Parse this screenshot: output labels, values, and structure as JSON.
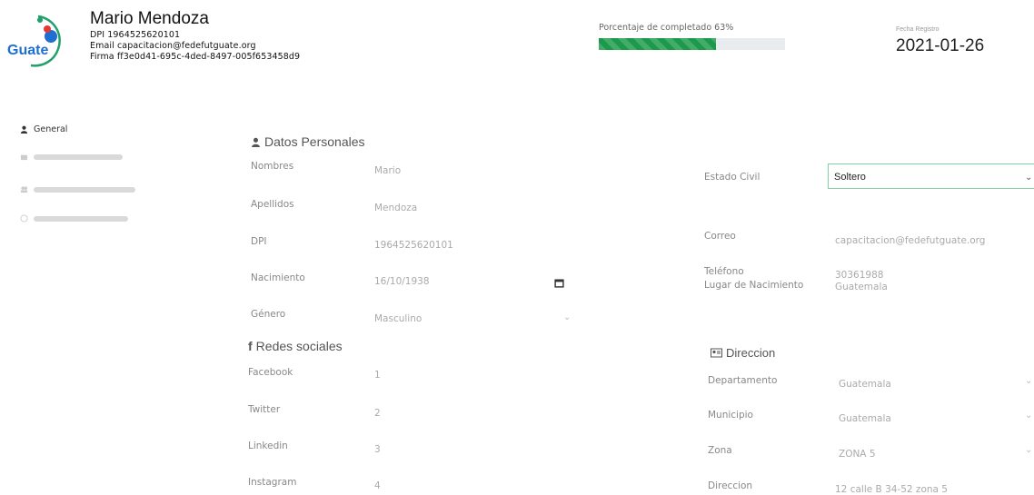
{
  "header": {
    "logo_text": "Guate",
    "name": "Mario Mendoza",
    "dpi_line": "DPI  1964525620101",
    "email_line": "Email  capacitacion@fedefutguate.org",
    "firma_line": "Firma  ff3e0d41-695c-4ded-8497-005f653458d9",
    "progress_label": "Porcentaje de completado 63%",
    "progress_value": 0.63,
    "progress_color": "#1a9a4a",
    "date_label": "Fecha Registro",
    "date_value": "2021-01-26"
  },
  "sidebar": {
    "items": [
      {
        "label": "General",
        "icon": "user-icon",
        "active": true
      },
      {
        "label": "",
        "icon": "briefcase-icon",
        "active": false
      },
      {
        "label": "",
        "icon": "users-icon",
        "active": false
      },
      {
        "label": "",
        "icon": "upload-icon",
        "active": false
      }
    ]
  },
  "personal": {
    "title": "Datos Personales",
    "fields": [
      {
        "label": "Nombres",
        "value": "Mario"
      },
      {
        "label": "Apellidos",
        "value": "Mendoza"
      },
      {
        "label": "DPI",
        "value": "1964525620101"
      },
      {
        "label": "Nacimiento",
        "value": "16/10/1938"
      },
      {
        "label": "Género",
        "value": "Masculino"
      }
    ],
    "right_fields": [
      {
        "label": "Estado Civil",
        "value": "Soltero"
      },
      {
        "label": "Correo",
        "value": "capacitacion@fedefutguate.org"
      },
      {
        "label": "Teléfono",
        "value": "30361988"
      },
      {
        "label": "Lugar de Nacimiento",
        "value": "Guatemala"
      }
    ]
  },
  "social": {
    "title": "Redes sociales",
    "fields": [
      {
        "label": "Facebook",
        "value": "1"
      },
      {
        "label": "Twitter",
        "value": "2"
      },
      {
        "label": "Linkedin",
        "value": "3"
      },
      {
        "label": "Instagram",
        "value": "4"
      }
    ]
  },
  "address": {
    "title": "Direccion",
    "fields": [
      {
        "label": "Departamento",
        "value": "Guatemala"
      },
      {
        "label": "Municipio",
        "value": "Guatemala"
      },
      {
        "label": "Zona",
        "value": "ZONA 5"
      },
      {
        "label": "Direccion",
        "value": "12 calle B 34-52 zona 5"
      }
    ]
  }
}
